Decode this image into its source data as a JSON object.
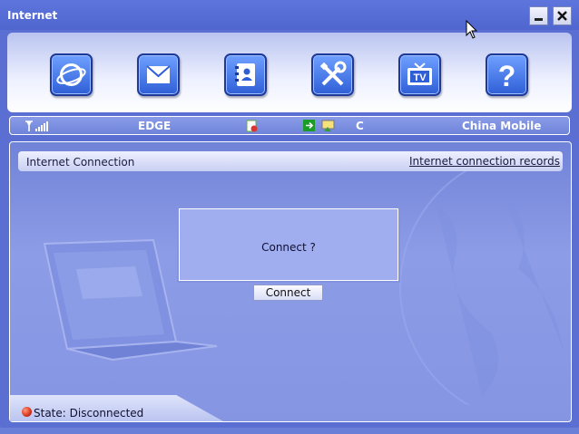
{
  "window": {
    "title": "Internet"
  },
  "toolbar": {
    "buttons": [
      {
        "icon": "internet-globe-icon"
      },
      {
        "icon": "envelope-icon"
      },
      {
        "icon": "phonebook-icon"
      },
      {
        "icon": "tools-icon"
      },
      {
        "icon": "tv-icon",
        "label": "TV"
      },
      {
        "icon": "help-icon",
        "label": "?"
      }
    ]
  },
  "status_strip": {
    "network_type": "EDGE",
    "carrier_state": "C",
    "operator": "China Mobile"
  },
  "panel": {
    "title": "Internet Connection",
    "records_link": "Internet connection records"
  },
  "dialog": {
    "message": "Connect ?",
    "connect_button": "Connect"
  },
  "footer": {
    "state": "State: Disconnected"
  },
  "colors": {
    "window_bg": "#5b6fd2",
    "accent": "#2f5fd6",
    "disconnected": "#d6321e"
  }
}
